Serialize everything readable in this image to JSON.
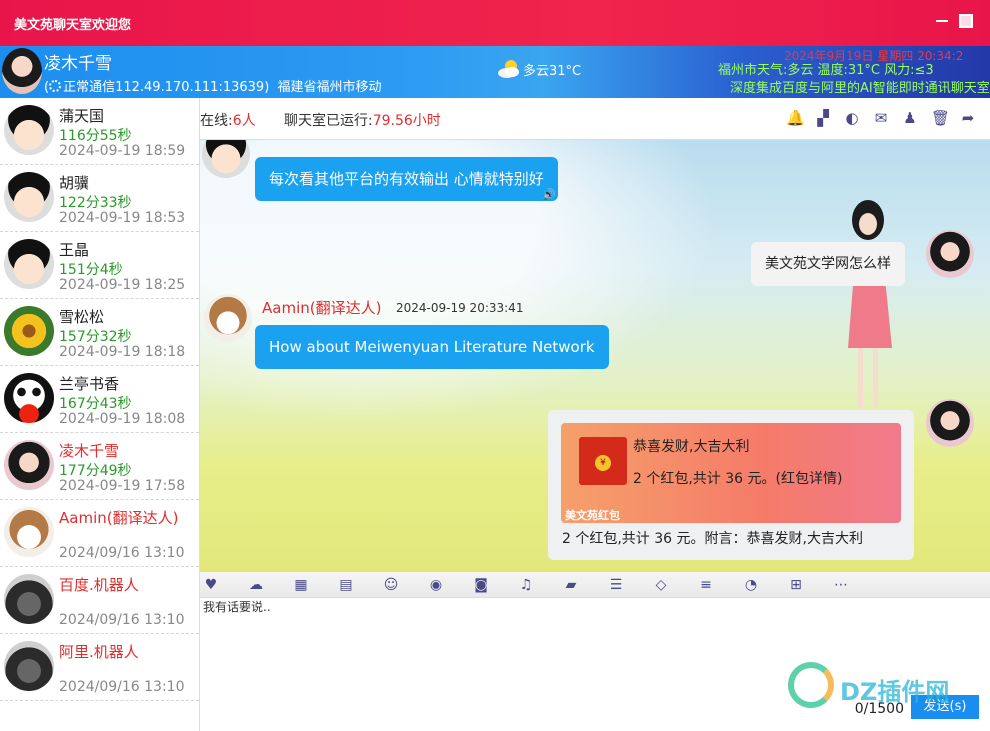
{
  "window": {
    "title": "美文苑聊天室欢迎您"
  },
  "header": {
    "user_name": "凌木千雪",
    "connection": "正常通信112.49.170.111:13639)",
    "location": "福建省福州市移动",
    "weather": "多云31°C",
    "date_line": "2024年9月19日 星期四 20:34:2",
    "city_weather": "福州市天气:多云 温度:31°C 风力:≤3",
    "marquee": "深度集成百度与阿里的AI智能即时通讯聊天室"
  },
  "sidebar": {
    "users": [
      {
        "name": "蒲天国",
        "duration": "116分55秒",
        "time": "2024-09-19 18:59",
        "avatar": "boy-avatar",
        "highlight": false
      },
      {
        "name": "胡骥",
        "duration": "122分33秒",
        "time": "2024-09-19 18:53",
        "avatar": "boy-avatar",
        "highlight": false
      },
      {
        "name": "王晶",
        "duration": "151分4秒",
        "time": "2024-09-19 18:25",
        "avatar": "boy-avatar",
        "highlight": false
      },
      {
        "name": "雪松松",
        "duration": "157分32秒",
        "time": "2024-09-19 18:18",
        "avatar": "flower-avatar",
        "highlight": false
      },
      {
        "name": "兰亭书香",
        "duration": "167分43秒",
        "time": "2024-09-19 18:08",
        "avatar": "panda-avatar",
        "highlight": false
      },
      {
        "name": "凌木千雪",
        "duration": "177分49秒",
        "time": "2024-09-19 17:58",
        "avatar": "girl-avatar",
        "highlight": true
      },
      {
        "name": "Aamin(翻译达人)",
        "duration": "",
        "time": "2024/09/16 13:10",
        "avatar": "dog-avatar",
        "highlight": true
      },
      {
        "name": "百度.机器人",
        "duration": "",
        "time": "2024/09/16 13:10",
        "avatar": "robot-avatar",
        "highlight": true
      },
      {
        "name": "阿里.机器人",
        "duration": "",
        "time": "2024/09/16 13:10",
        "avatar": "robot-avatar",
        "highlight": true
      }
    ]
  },
  "topbar": {
    "online_label": "在线:",
    "online_count": "6人",
    "runtime_label": "聊天室已运行:",
    "runtime_value": "79.56小时",
    "icons": [
      "bell-icon",
      "checker-icon",
      "toggle-icon",
      "mail-icon",
      "qq-icon",
      "trash-icon",
      "share-icon"
    ]
  },
  "messages": {
    "m1_text": "每次看其他平台的有效输出 心情就特别好",
    "m2_text": "美文苑文学网怎么样",
    "m3_sender": "Aamin(翻译达人)",
    "m3_time": "2024-09-19 20:33:41",
    "m3_text": "How about Meiwenyuan Literature Network",
    "red_packet": {
      "wish": "恭喜发财,大吉大利",
      "info": "2 个红包,共计 36 元。(红包详情)",
      "brand": "美文苑红包",
      "detail": "2 个红包,共计 36 元。附言：恭喜发财,大吉大利"
    }
  },
  "toolbar": {
    "icons": [
      "heart-icon",
      "cloud-icon",
      "map-icon",
      "id-card-icon",
      "smile-icon",
      "user-circle-icon",
      "camera-icon",
      "music-icon",
      "folder-icon",
      "server-icon",
      "diamond-icon",
      "database-icon",
      "rss-icon",
      "windows-icon",
      "more-icon"
    ]
  },
  "input": {
    "placeholder": "我有话要说..",
    "counter": "0/1500",
    "send_label": "发送(s)"
  },
  "watermark": {
    "text": "DZ插件网"
  },
  "colors": {
    "title_bar": "#e8154a",
    "accent_blue": "#1aa2f0",
    "highlight_red": "#e02d2d",
    "duration_green": "#2a9a2a"
  }
}
